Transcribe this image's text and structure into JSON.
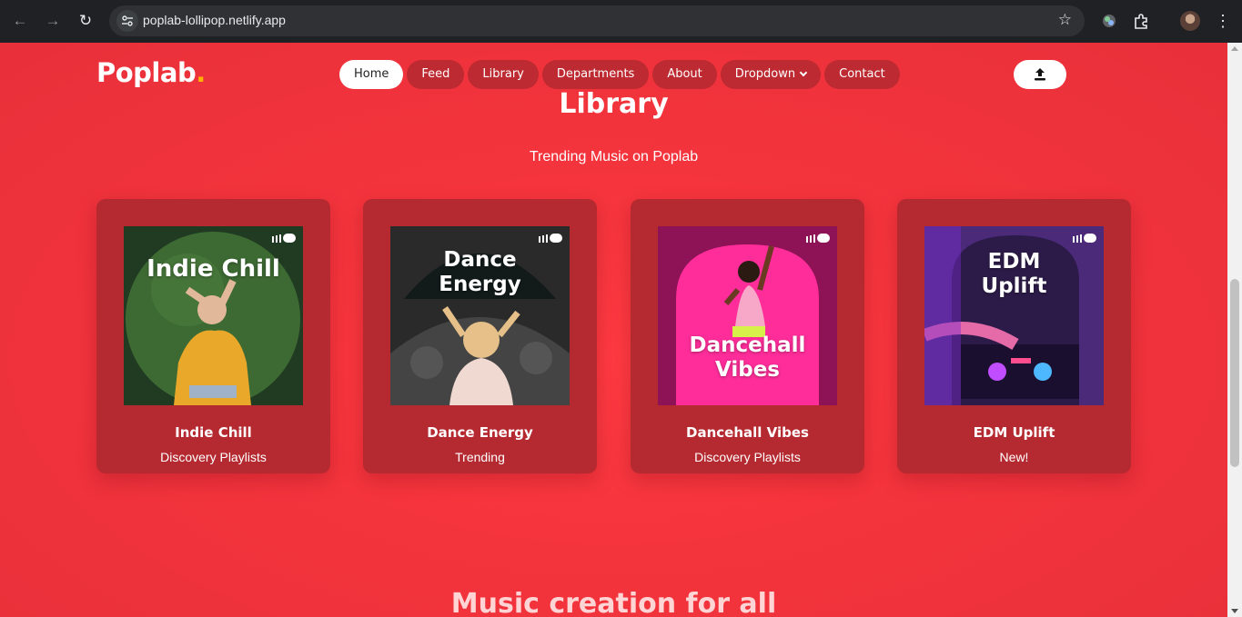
{
  "browser": {
    "url": "poplab-lollipop.netlify.app",
    "icons": [
      "back-icon",
      "forward-icon",
      "reload-icon",
      "site-info-icon",
      "star-icon",
      "extension-icon",
      "puzzle-icon",
      "profile-avatar",
      "more-icon"
    ]
  },
  "header": {
    "logo_text": "Poplab",
    "logo_dot": ".",
    "nav": [
      {
        "label": "Home",
        "active": true
      },
      {
        "label": "Feed",
        "active": false
      },
      {
        "label": "Library",
        "active": false
      },
      {
        "label": "Departments",
        "active": false
      },
      {
        "label": "About",
        "active": false
      },
      {
        "label": "Dropdown",
        "active": false,
        "has_chevron": true
      },
      {
        "label": "Contact",
        "active": false
      }
    ],
    "upload_icon": "upload-icon"
  },
  "library": {
    "title": "Library",
    "subtitle": "Trending Music on Poplab",
    "cards": [
      {
        "cover_text": "Indie Chill",
        "title": "Indie Chill",
        "subtitle": "Discovery Playlists"
      },
      {
        "cover_text": "Dance Energy",
        "title": "Dance Energy",
        "subtitle": "Trending"
      },
      {
        "cover_text": "Dancehall Vibes",
        "title": "Dancehall Vibes",
        "subtitle": "Discovery Playlists"
      },
      {
        "cover_text": "EDM Uplift",
        "title": "EDM Uplift",
        "subtitle": "New!"
      }
    ]
  },
  "next_section": {
    "title": "Music creation for all"
  },
  "colors": {
    "page_bg": "#f5343d",
    "card_bg": "#b52a31",
    "nav_pill": "#bd2a31",
    "logo_dot": "#ffb300"
  }
}
